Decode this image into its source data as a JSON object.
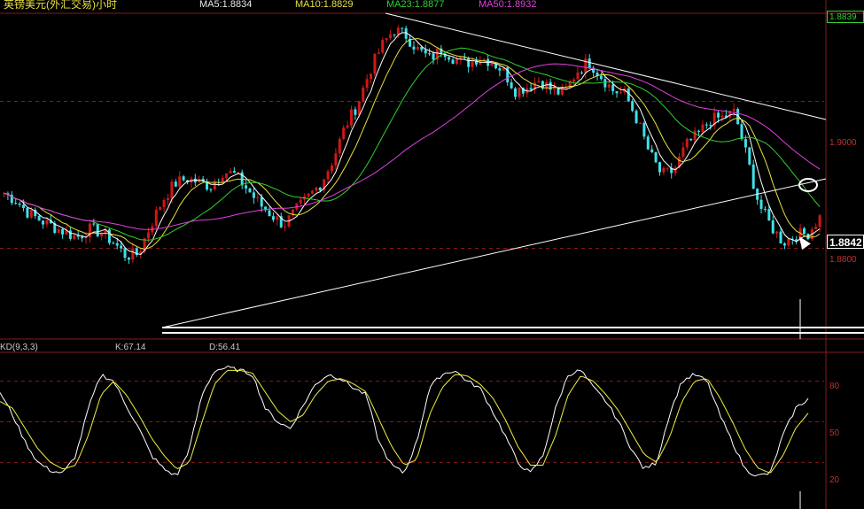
{
  "header": {
    "title": "英镑美元(外汇交易)小时",
    "ma5": "MA5:1.8834",
    "ma10": "MA10:1.8829",
    "ma23": "MA23:1.8877",
    "ma50": "MA50:1.8932"
  },
  "kdj": {
    "name": "KD(9,3,3)",
    "k": "K:67.14",
    "d": "D:56.41"
  },
  "price_axis": {
    "top_label": "1.8839",
    "mid_label": "1.9000",
    "low_label": "1.8800",
    "current": "1.8842"
  },
  "kdj_axis": {
    "l80": "80",
    "l50": "50",
    "l20": "20"
  },
  "colors": {
    "up": "#d01818",
    "down": "#40e0e8",
    "ma5": "#ffffff",
    "ma10": "#e8e040",
    "ma23": "#30d030",
    "ma50": "#e040e0",
    "k_line": "#ffffff",
    "d_line": "#f0f040",
    "grid": "#8a1a1a"
  },
  "chart_data": [
    {
      "type": "candlestick",
      "title": "英镑美元(外汇交易)小时",
      "ylim": [
        1.868,
        1.912
      ],
      "y_ticks": [
        1.88,
        1.9
      ],
      "close_series": [
        1.8875,
        1.8865,
        1.8848,
        1.8838,
        1.883,
        1.8822,
        1.8815,
        1.8826,
        1.8822,
        1.8808,
        1.879,
        1.8792,
        1.883,
        1.8865,
        1.8888,
        1.8895,
        1.889,
        1.8885,
        1.8905,
        1.89,
        1.888,
        1.886,
        1.8845,
        1.8832,
        1.8852,
        1.887,
        1.8888,
        1.892,
        1.8965,
        1.8995,
        1.904,
        1.9075,
        1.9098,
        1.909,
        1.907,
        1.9058,
        1.9072,
        1.9058,
        1.9052,
        1.906,
        1.9055,
        1.9042,
        1.9015,
        1.902,
        1.903,
        1.9015,
        1.901,
        1.904,
        1.9055,
        1.9035,
        1.9015,
        1.901,
        1.8975,
        1.893,
        1.89,
        1.8905,
        1.894,
        1.8955,
        1.8975,
        1.8978,
        1.8985,
        1.8925,
        1.886,
        1.883,
        1.8808,
        1.8818,
        1.882,
        1.8842
      ],
      "series": [
        {
          "name": "MA5",
          "last": 1.8834
        },
        {
          "name": "MA10",
          "last": 1.8829
        },
        {
          "name": "MA23",
          "last": 1.8877
        },
        {
          "name": "MA50",
          "last": 1.8932
        }
      ]
    },
    {
      "type": "line",
      "title": "KD(9,3,3)",
      "ylim": [
        0,
        100
      ],
      "y_ticks": [
        20,
        50,
        80
      ],
      "series": [
        {
          "name": "K",
          "last": 67.14,
          "values": [
            72,
            55,
            35,
            20,
            14,
            12,
            25,
            60,
            85,
            80,
            62,
            45,
            25,
            15,
            10,
            30,
            70,
            88,
            90,
            88,
            85,
            60,
            50,
            45,
            62,
            78,
            85,
            82,
            75,
            70,
            35,
            18,
            12,
            35,
            75,
            85,
            88,
            80,
            75,
            58,
            40,
            20,
            12,
            25,
            60,
            85,
            88,
            75,
            65,
            50,
            30,
            15,
            20,
            55,
            80,
            85,
            80,
            55,
            35,
            15,
            10,
            12,
            40,
            60,
            67
          ]
        },
        {
          "name": "D",
          "last": 56.41,
          "values": [
            65,
            60,
            45,
            30,
            20,
            15,
            18,
            40,
            70,
            80,
            70,
            55,
            38,
            25,
            15,
            20,
            50,
            78,
            88,
            88,
            86,
            72,
            58,
            50,
            55,
            70,
            80,
            82,
            78,
            72,
            52,
            32,
            18,
            22,
            55,
            75,
            85,
            84,
            78,
            68,
            52,
            32,
            18,
            18,
            40,
            70,
            84,
            80,
            70,
            58,
            42,
            26,
            20,
            38,
            65,
            80,
            82,
            68,
            50,
            30,
            16,
            12,
            25,
            45,
            56.41
          ]
        }
      ]
    }
  ]
}
